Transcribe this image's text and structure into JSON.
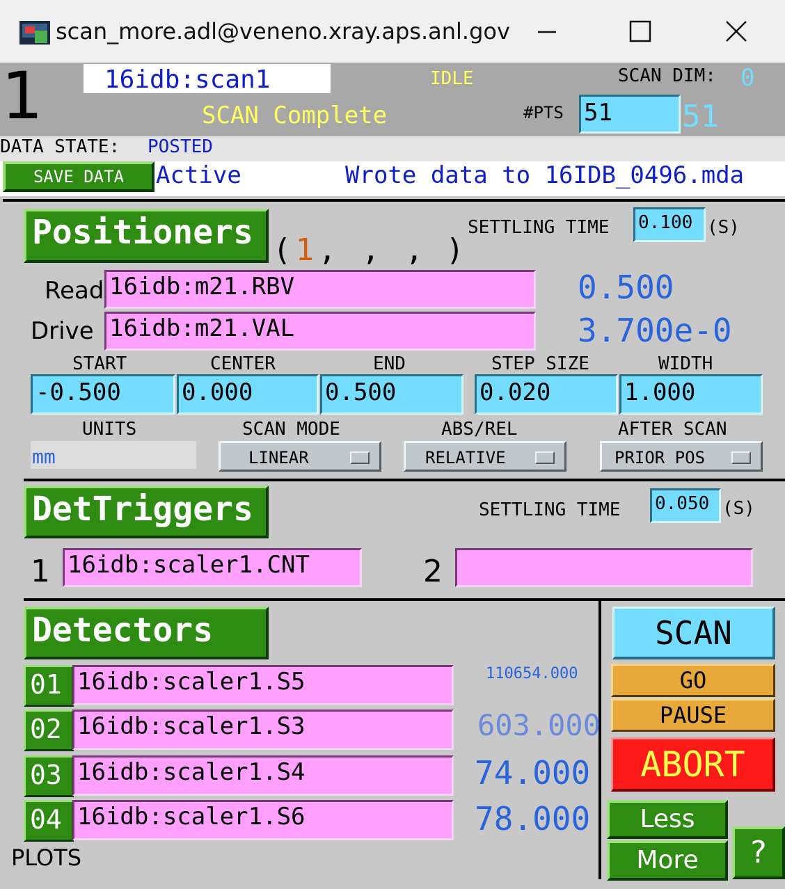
{
  "window": {
    "title": "scan_more.adl@veneno.xray.aps.anl.gov",
    "minimize_glyph": "—",
    "maximize_glyph": "☐",
    "close_glyph": "✕"
  },
  "header": {
    "scan_number": "1",
    "scan_pv": "16idb:scan1",
    "state": "IDLE",
    "scan_dim_label": "SCAN DIM:",
    "scan_dim_value": "0",
    "message": "SCAN Complete",
    "npts_label": "#PTS",
    "npts_input": "51",
    "npts_readback": "51"
  },
  "data_state": {
    "label": "DATA STATE:",
    "value": "POSTED",
    "save_button": "SAVE DATA",
    "save_status": "Active",
    "file_message": "Wrote data to 16IDB_0496.mda"
  },
  "positioners": {
    "header": "Positioners",
    "indices": [
      "(",
      "1",
      ",",
      ",",
      ",",
      ")"
    ],
    "settling_label": "SETTLING TIME",
    "settling_value": "0.100",
    "settling_unit": "(S)",
    "read_label": "Read",
    "read_pv": "16idb:m21.RBV",
    "read_value": "0.500",
    "drive_label": "Drive",
    "drive_pv": "16idb:m21.VAL",
    "drive_value": "3.700e-0",
    "start_label": "START",
    "center_label": "CENTER",
    "end_label": "END",
    "step_label": "STEP SIZE",
    "width_label": "WIDTH",
    "start": "-0.500",
    "center": "0.000",
    "end": "0.500",
    "step": "0.020",
    "width": "1.000",
    "units_label": "UNITS",
    "units_value": "mm",
    "scan_mode_label": "SCAN MODE",
    "scan_mode_value": "LINEAR",
    "absrel_label": "ABS/REL",
    "absrel_value": "RELATIVE",
    "after_scan_label": "AFTER SCAN",
    "after_scan_value": "PRIOR POS"
  },
  "triggers": {
    "header": "DetTriggers",
    "settling_label": "SETTLING TIME",
    "settling_value": "0.050",
    "settling_unit": "(S)",
    "t1_label": "1",
    "t1_pv": "16idb:scaler1.CNT",
    "t2_label": "2",
    "t2_pv": ""
  },
  "detectors": {
    "header": "Detectors",
    "rows": [
      {
        "num": "01",
        "pv": "16idb:scaler1.S5",
        "value": "110654.000"
      },
      {
        "num": "02",
        "pv": "16idb:scaler1.S3",
        "value": "603.000"
      },
      {
        "num": "03",
        "pv": "16idb:scaler1.S4",
        "value": "74.000"
      },
      {
        "num": "04",
        "pv": "16idb:scaler1.S6",
        "value": "78.000"
      }
    ],
    "plots_label": "PLOTS"
  },
  "controls": {
    "scan": "SCAN",
    "go": "GO",
    "pause": "PAUSE",
    "abort": "ABORT",
    "less": "Less",
    "more": "More",
    "help": "?"
  },
  "colors": {
    "green": "#2e8c12",
    "pink": "#ffa0ff",
    "cyan": "#73dcff",
    "yellow_text": "#ffff60",
    "blue_value": "#2a64dc",
    "abort_red": "#ff1a1a",
    "go_orange": "#e8a83a"
  }
}
